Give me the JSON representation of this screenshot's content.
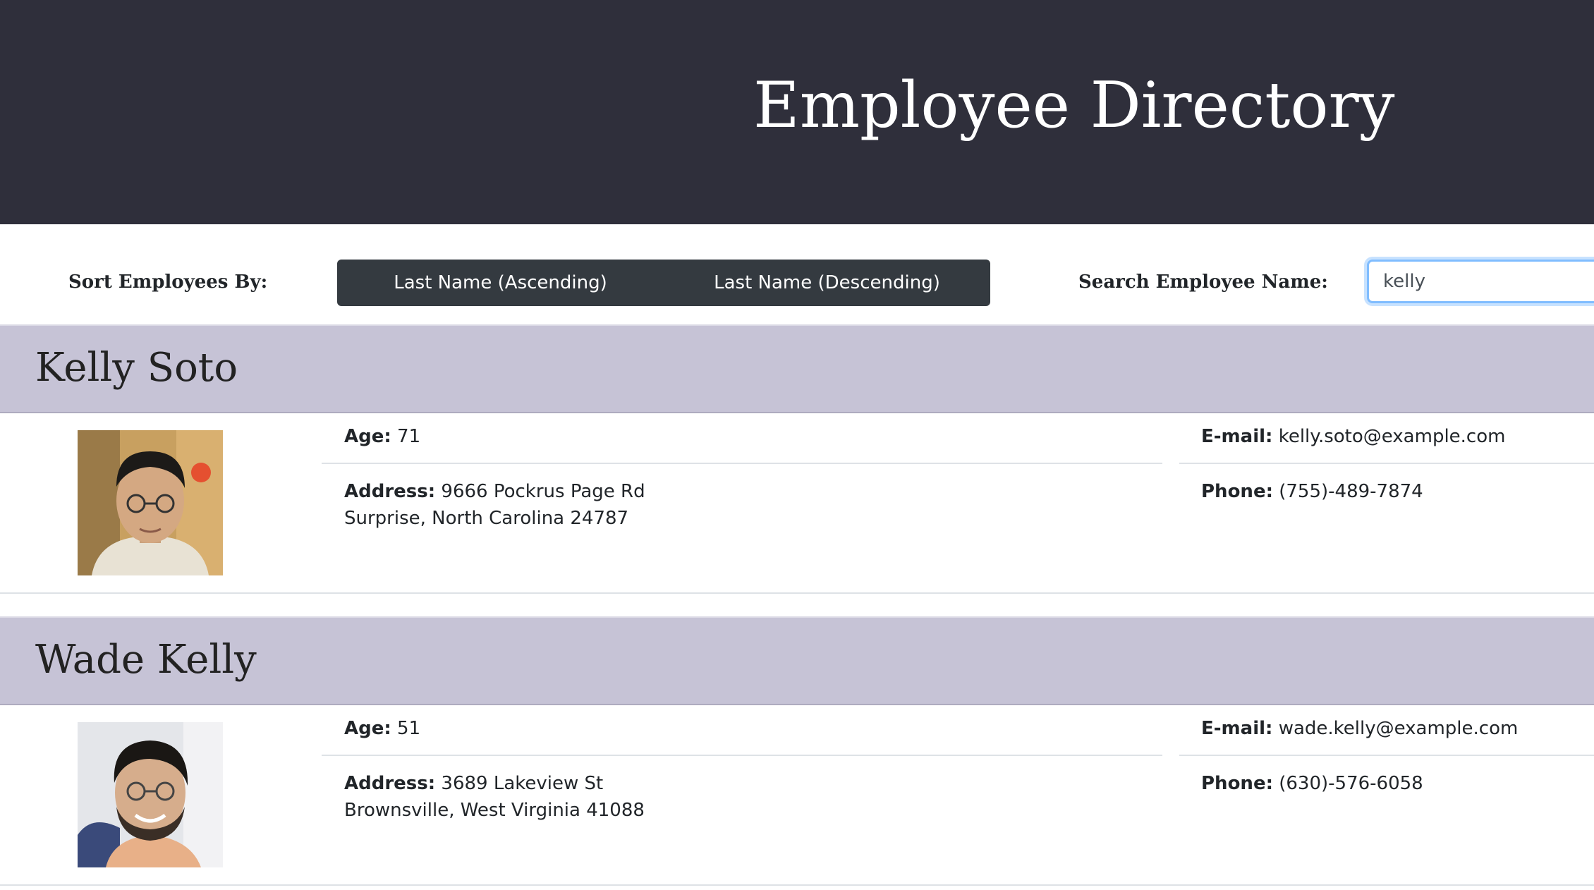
{
  "header": {
    "title": "Employee Directory"
  },
  "toolbar": {
    "sort_label": "Sort Employees By:",
    "sort_ascending_label": "Last Name (Ascending)",
    "sort_descending_label": "Last Name (Descending)",
    "search_label": "Search Employee Name:",
    "search_value": "kelly"
  },
  "labels": {
    "age": "Age:",
    "address": "Address:",
    "email": "E-mail:",
    "phone": "Phone:"
  },
  "employees": [
    {
      "name": "Kelly Soto",
      "age": "71",
      "address_line1": "9666 Pockrus Page Rd",
      "address_line2": "Surprise, North Carolina 24787",
      "email": "kelly.soto@example.com",
      "phone": "(755)-489-7874"
    },
    {
      "name": "Wade Kelly",
      "age": "51",
      "address_line1": "3689 Lakeview St",
      "address_line2": "Brownsville, West Virginia 41088",
      "email": "wade.kelly@example.com",
      "phone": "(630)-576-6058"
    }
  ]
}
